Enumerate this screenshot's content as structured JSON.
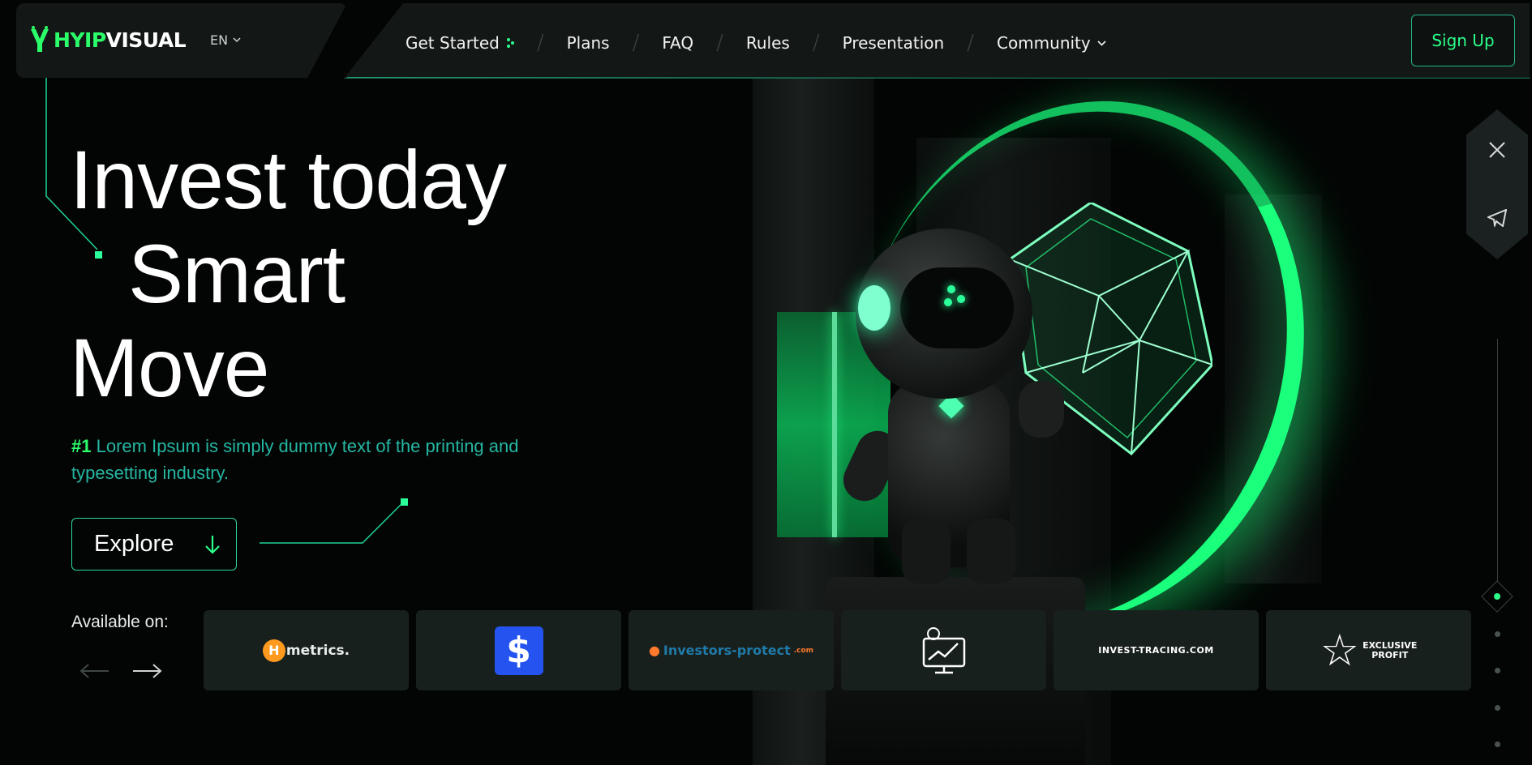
{
  "brand": {
    "logo_highlight": "HYIP",
    "logo_rest": "VISUAL"
  },
  "language": {
    "label": "EN"
  },
  "nav": {
    "items": [
      {
        "label": "Get Started"
      },
      {
        "label": "Plans"
      },
      {
        "label": "FAQ"
      },
      {
        "label": "Rules"
      },
      {
        "label": "Presentation"
      },
      {
        "label": "Community"
      }
    ],
    "signup_label": "Sign Up"
  },
  "hero": {
    "title_line1": "Invest today",
    "title_line2": "Smart",
    "title_line3": "Move",
    "subtitle_rank": "#1",
    "subtitle_text": "Lorem Ipsum is simply dummy text of the printing and typesetting industry.",
    "explore_label": "Explore"
  },
  "available": {
    "label": "Available on:",
    "partners": [
      {
        "name": "Hmetrics",
        "logo_prefix": "H",
        "logo_text": "metrics."
      },
      {
        "name": "$",
        "logo_text": "$"
      },
      {
        "name": "investors-protect",
        "logo_text": "Investors-protect",
        "logo_suffix": ".com"
      },
      {
        "name": "monitor-icon"
      },
      {
        "name": "invest-tracing",
        "logo_text": "INVEST-TRACING.COM"
      },
      {
        "name": "exclusive-profit",
        "logo_line1": "EXCLUSIVE",
        "logo_line2": "PROFIT"
      }
    ]
  },
  "colors": {
    "accent": "#2bff8a",
    "teal": "#25b6a2",
    "panel": "#131816"
  },
  "icons": [
    "x-twitter-icon",
    "telegram-icon",
    "chevron-down-icon",
    "arrow-down-icon",
    "arrow-left-icon",
    "arrow-right-icon"
  ]
}
